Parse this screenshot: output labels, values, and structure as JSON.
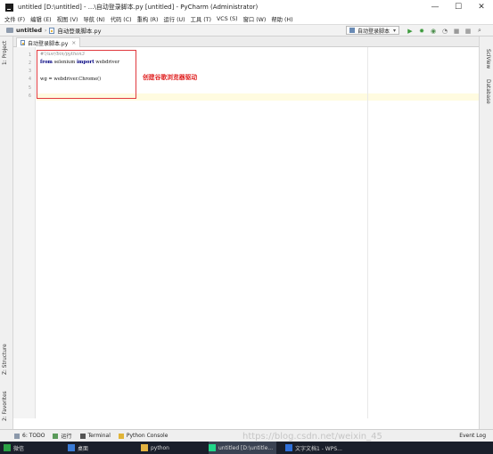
{
  "window": {
    "title": "untitled [D:\\untitled] - ...\\自动登录脚本.py [untitled] - PyCharm (Administrator)",
    "minimize": "—",
    "maximize": "☐",
    "close": "✕"
  },
  "menu": [
    "文件 (F)",
    "编辑 (E)",
    "视图 (V)",
    "导航 (N)",
    "代码 (C)",
    "重构 (R)",
    "运行 (U)",
    "工具 (T)",
    "VCS (S)",
    "窗口 (W)",
    "帮助 (H)"
  ],
  "breadcrumb": {
    "project": "untitled",
    "file": "自动登录脚本.py"
  },
  "run_config": {
    "label": "自动登录脚本"
  },
  "left_panel": {
    "project": "1: Project",
    "structure": "Z: Structure",
    "favorites": "2: Favorites"
  },
  "right_panel": {
    "sciview": "SciView",
    "database": "Database"
  },
  "tab": {
    "label": "自动登录脚本.py",
    "close": "×"
  },
  "editor": {
    "line_numbers": [
      "1",
      "2",
      "3",
      "4",
      "5",
      "6"
    ],
    "lines": [
      {
        "type": "comment",
        "text": "#!/usr/bin/python3"
      },
      {
        "type": "import",
        "kw1": "from",
        "mod": " selenium ",
        "kw2": "import",
        "rest": "  webdriver"
      },
      {
        "type": "blank",
        "text": ""
      },
      {
        "type": "code",
        "text": "wg = webdriver.Chrome()"
      },
      {
        "type": "blank",
        "text": ""
      },
      {
        "type": "blank",
        "text": ""
      }
    ],
    "annotation": "创建谷歌浏览器驱动"
  },
  "bottom_tools": [
    "6: TODO",
    "运行",
    "Terminal",
    "Python Console"
  ],
  "event_log": "Event Log",
  "watermark": "https://blog.csdn.net/weixin_45",
  "taskbar": [
    "微信",
    "桌面",
    "python",
    "untitled [D:\\untitle...",
    "文字文档1 - WPS..."
  ]
}
